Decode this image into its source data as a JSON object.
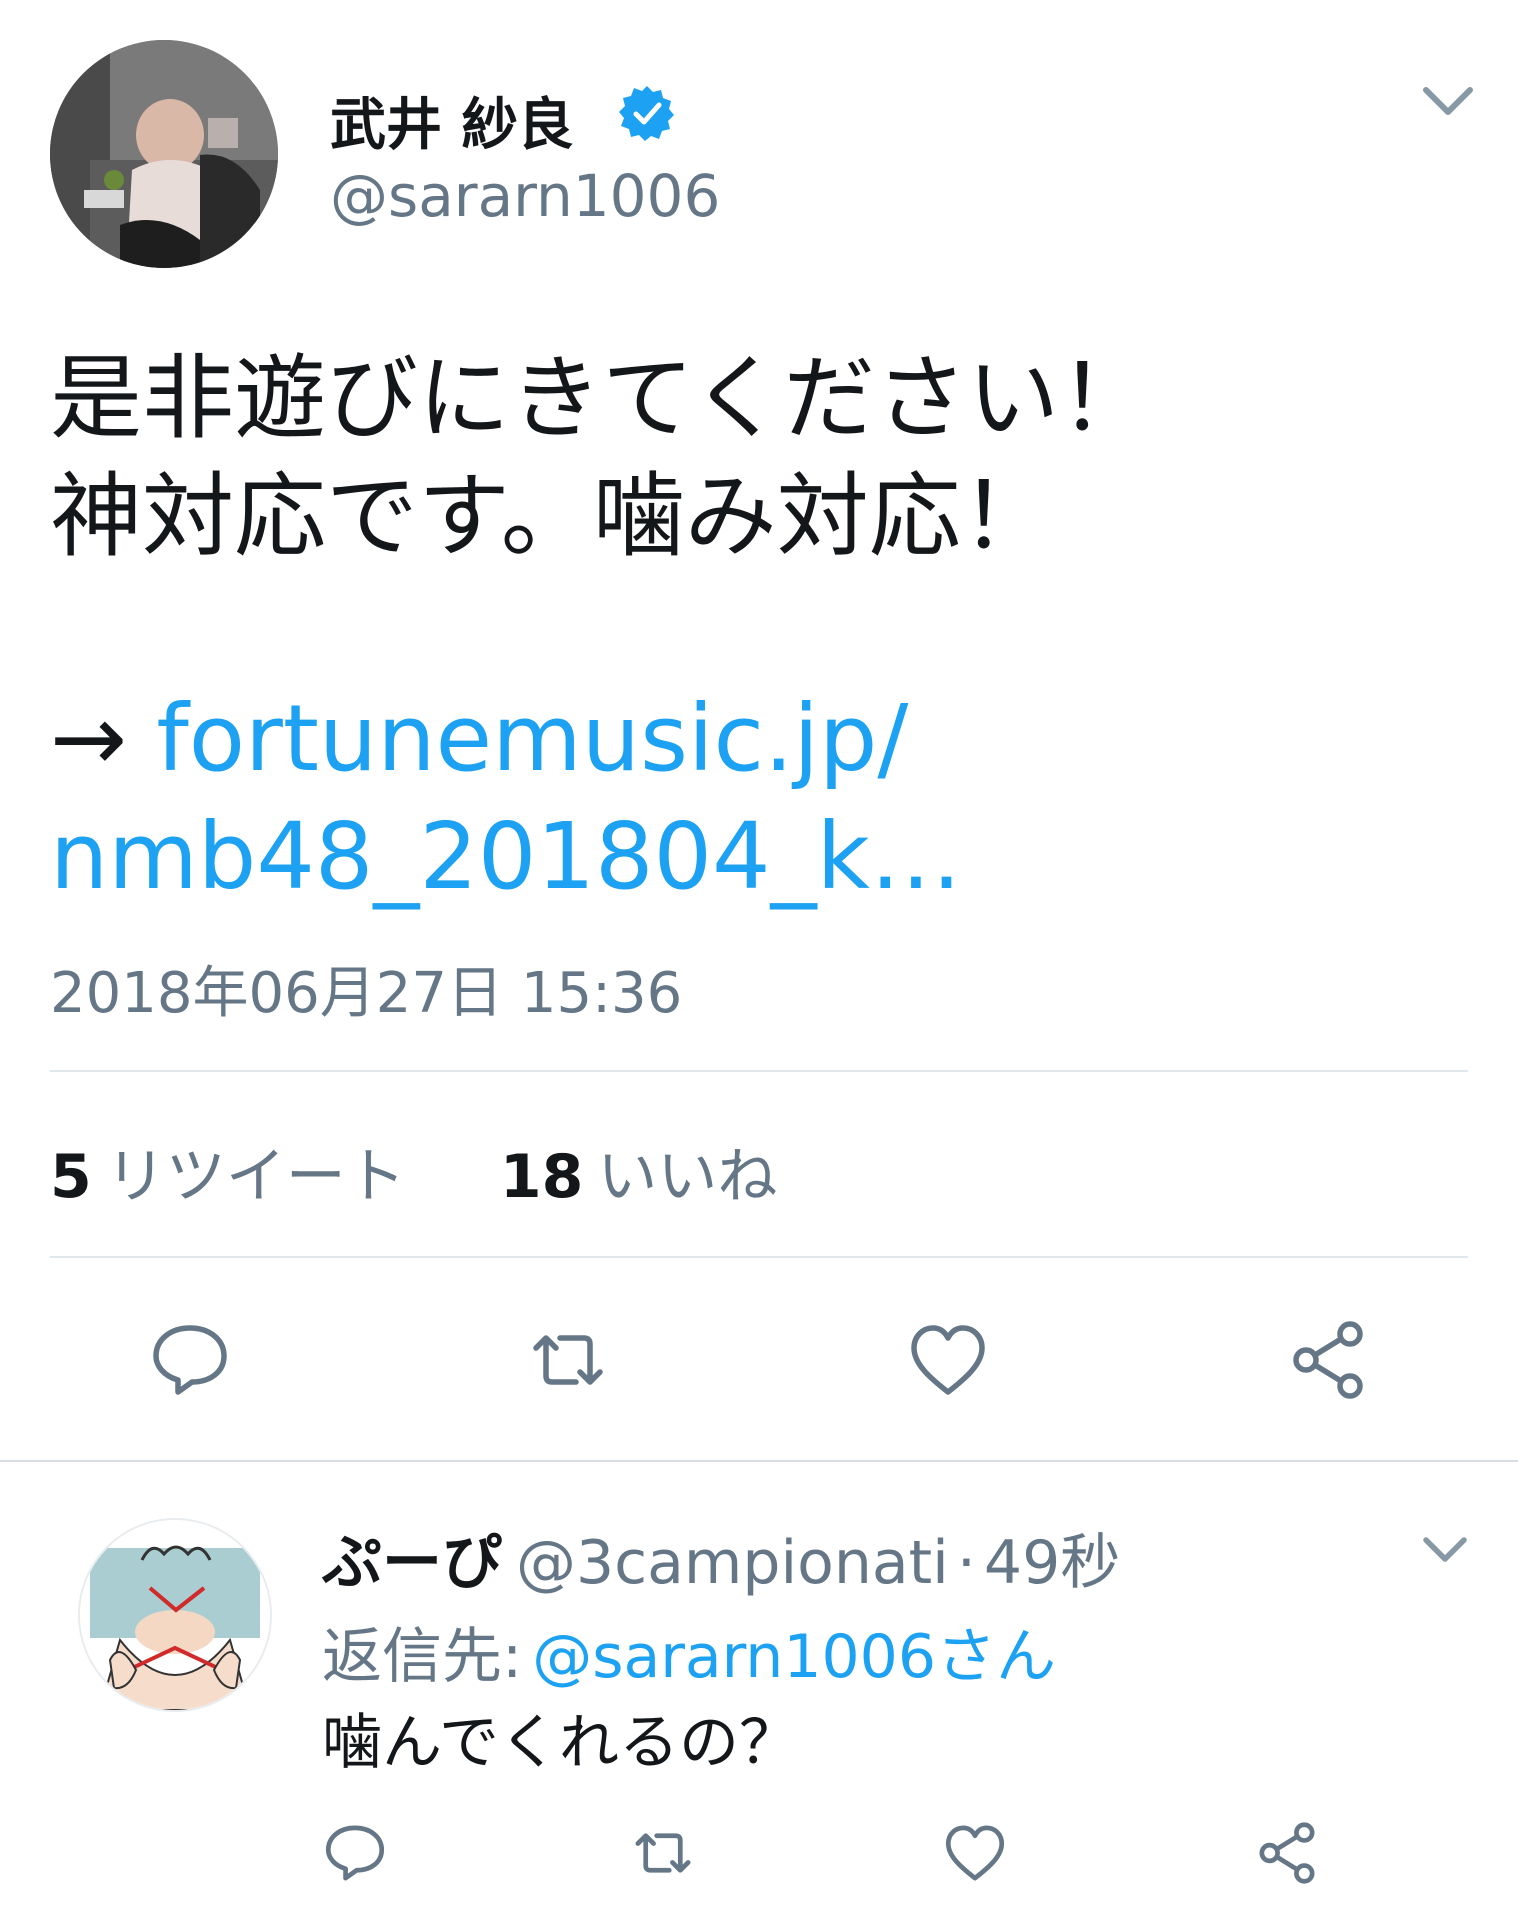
{
  "tweet": {
    "display_name": "武井 紗良",
    "handle": "@sararn1006",
    "verified": true,
    "text_lines": [
      "是非遊びにきてください！",
      "神対応です。噛み対応！"
    ],
    "link_arrow": "→",
    "link_line1": "fortunemusic.jp/",
    "link_line2": "nmb48_201804_k…",
    "timestamp": "2018年06月27日 15:36",
    "retweet_count": "5",
    "retweet_label": "リツイート",
    "like_count": "18",
    "like_label": "いいね"
  },
  "reply": {
    "display_name": "ぷーぴ",
    "handle": "@3campionati",
    "separator": "·",
    "time": "49秒",
    "reply_to_label": "返信先:",
    "reply_to_user": "@sararn1006さん",
    "text": "噛んでくれるの？"
  },
  "icons": {
    "verified": "verified-badge-icon",
    "caret": "chevron-down-icon",
    "reply": "reply-bubble-icon",
    "retweet": "retweet-icon",
    "like": "heart-icon",
    "share": "share-icon"
  },
  "colors": {
    "accent": "#1da1f2",
    "secondary_text": "#657786",
    "primary_text": "#14171a",
    "divider": "#e1e8ed"
  }
}
